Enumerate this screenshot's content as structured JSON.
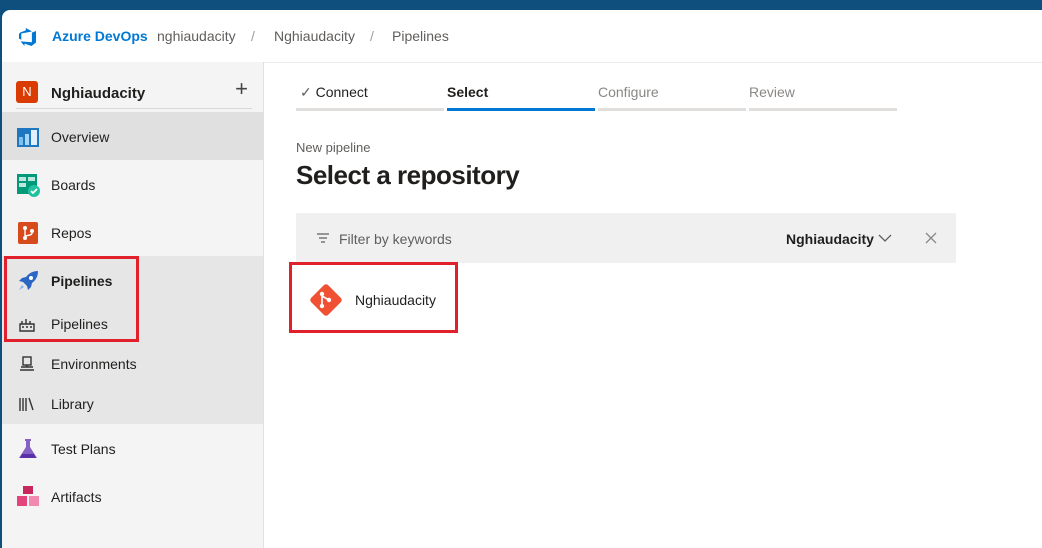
{
  "header": {
    "brand": "Azure DevOps",
    "breadcrumb": [
      "nghiaudacity",
      "Nghiaudacity",
      "Pipelines"
    ],
    "separator": "/"
  },
  "sidebar": {
    "project_initial": "N",
    "project_name": "Nghiaudacity",
    "add_symbol": "+",
    "items": [
      {
        "label": "Overview",
        "icon": "overview-icon"
      },
      {
        "label": "Boards",
        "icon": "boards-icon"
      },
      {
        "label": "Repos",
        "icon": "repos-icon"
      },
      {
        "label": "Pipelines",
        "icon": "pipelines-icon"
      },
      {
        "label": "Test Plans",
        "icon": "test-plans-icon"
      },
      {
        "label": "Artifacts",
        "icon": "artifacts-icon"
      }
    ],
    "subitems": [
      {
        "label": "Pipelines",
        "icon": "pipelines-sub-icon"
      },
      {
        "label": "Environments",
        "icon": "environments-icon"
      },
      {
        "label": "Library",
        "icon": "library-icon"
      }
    ]
  },
  "wizard": {
    "steps": [
      {
        "label": "Connect",
        "state": "done"
      },
      {
        "label": "Select",
        "state": "active"
      },
      {
        "label": "Configure",
        "state": "pending"
      },
      {
        "label": "Review",
        "state": "pending"
      }
    ],
    "check_mark": "✓"
  },
  "main": {
    "subtitle": "New pipeline",
    "title": "Select a repository",
    "filter_placeholder": "Filter by keywords",
    "filter_scope": "Nghiaudacity",
    "repositories": [
      {
        "name": "Nghiaudacity",
        "icon": "git-icon"
      }
    ]
  },
  "colors": {
    "accent": "#0078d4",
    "highlight": "#e0202a",
    "topbar": "#0f4f7e"
  }
}
